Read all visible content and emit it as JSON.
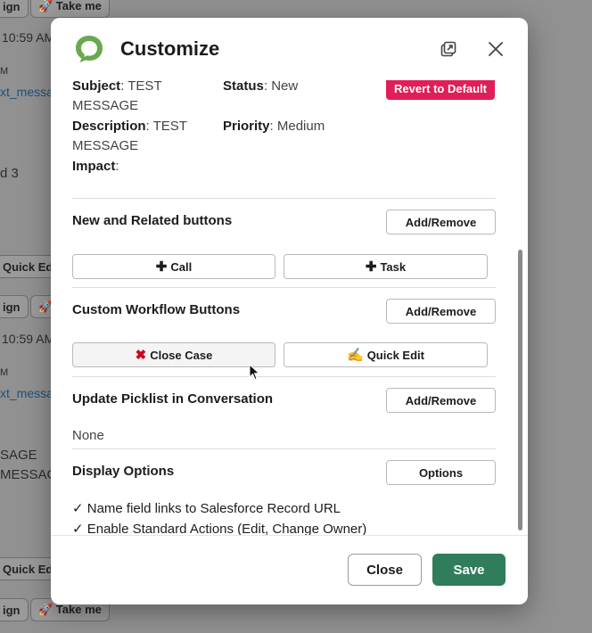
{
  "background": {
    "texts": [
      "ign",
      "10:59 AM",
      "M",
      "xt_messa",
      "d 3",
      "10:59 AM",
      "M",
      "xt_messa",
      "SAGE",
      "MESSAG"
    ],
    "chips": [
      "🚀 Take me",
      "Quick Ed",
      "ign",
      "🚀",
      "Quick Ed",
      "ign",
      "🚀 Take me"
    ]
  },
  "modal": {
    "title": "Customize",
    "record": {
      "subject_label": "Subject",
      "subject_value": "TEST MESSAGE",
      "status_label": "Status",
      "status_value": "New",
      "description_label": "Description",
      "description_value": "TEST MESSAGE",
      "priority_label": "Priority",
      "priority_value": "Medium",
      "impact_label": "Impact",
      "revert_label": "Revert to Default"
    },
    "sections": {
      "new_related": {
        "title": "New and Related buttons",
        "add_remove": "Add/Remove",
        "call": "Call",
        "task": "Task"
      },
      "workflow": {
        "title": "Custom Workflow Buttons",
        "add_remove": "Add/Remove",
        "close_case": "Close Case",
        "quick_edit": "Quick Edit"
      },
      "picklist": {
        "title": "Update Picklist in Conversation",
        "add_remove": "Add/Remove",
        "value": "None"
      },
      "display": {
        "title": "Display Options",
        "options": "Options",
        "lines": [
          "✓ Name field links to Salesforce Record URL",
          "✓ Enable Standard Actions (Edit, Change Owner)"
        ]
      }
    },
    "footer": {
      "close": "Close",
      "save": "Save"
    }
  },
  "colors": {
    "save": "#2f7d5b",
    "revert": "#e01e5a",
    "logo": "#6aa84f"
  }
}
